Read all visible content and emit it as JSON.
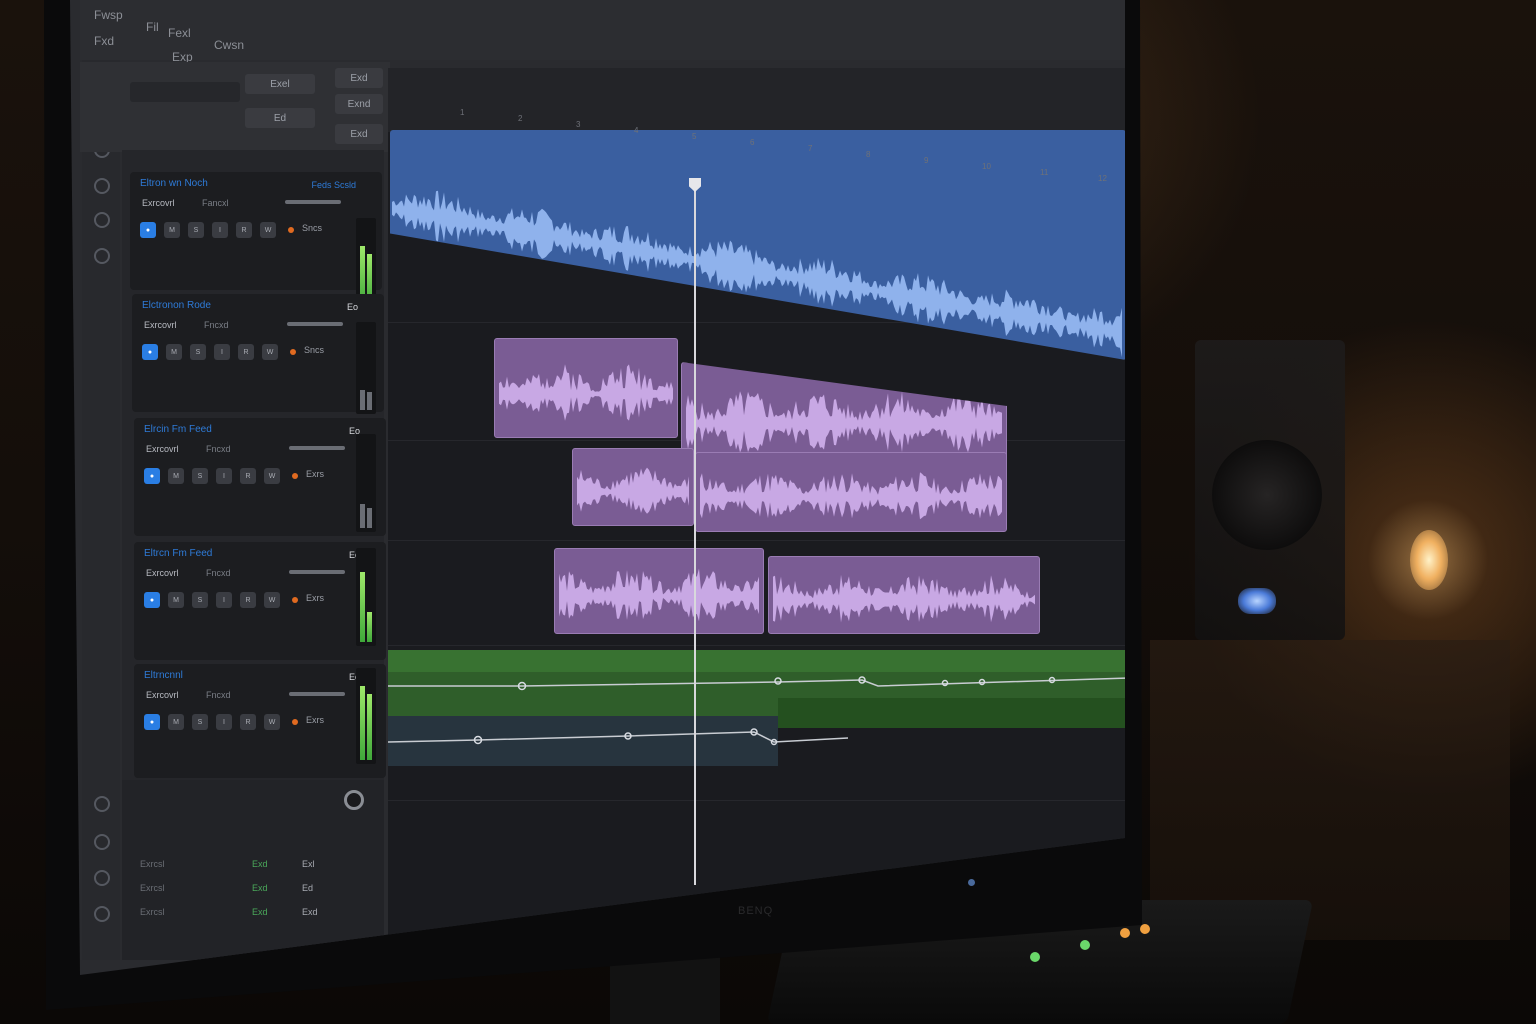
{
  "menubar": {
    "items": [
      "Fwsp",
      "Fil",
      "Fexl",
      "Cwsn",
      "Fxd",
      "Exp"
    ]
  },
  "toolbar": {
    "right_labels": [
      "Exd",
      "Exnd",
      "Exd"
    ],
    "center_labels": [
      "Exel",
      "Ed"
    ]
  },
  "tracks": [
    {
      "name": "Eltron wn Noch",
      "label1": "Exrcovrl",
      "label2": "Fancxl",
      "right": "Feds Scsld",
      "send": "Sncs"
    },
    {
      "name": "Elctronon Rode",
      "label1": "Exrcovrl",
      "label2": "Fncxd",
      "right": "Eo",
      "send": "Sncs"
    },
    {
      "name": "Elrcin Fm Feed",
      "label1": "Exrcovrl",
      "label2": "Fncxd",
      "right": "Eo",
      "send": "Exrs"
    },
    {
      "name": "Eltrcn Fm Feed",
      "label1": "Exrcovrl",
      "label2": "Fncxd",
      "right": "Eo",
      "send": "Exrs"
    },
    {
      "name": "Eltrncnnl",
      "label1": "Exrcovrl",
      "label2": "Fncxd",
      "right": "Eo",
      "send": "Exrs"
    }
  ],
  "master": {
    "rows": [
      {
        "name": "Exrcsl",
        "val": "Exd",
        "val2": "Exl"
      },
      {
        "name": "Exrcsl",
        "val": "Exd",
        "val2": "Ed"
      },
      {
        "name": "Exrcsl",
        "val": "Exd",
        "val2": "Exd"
      }
    ]
  },
  "ruler": {
    "marks": [
      "1",
      "2",
      "3",
      "4",
      "5",
      "6",
      "7",
      "8",
      "9",
      "10",
      "11",
      "12"
    ]
  },
  "monitor": {
    "brand": "BENQ"
  },
  "colors": {
    "blue_region": "#3a5fa0",
    "purple_region": "#7a5c94",
    "green_automation": "#2f6a2a",
    "record_blue": "#2a7ee4"
  }
}
